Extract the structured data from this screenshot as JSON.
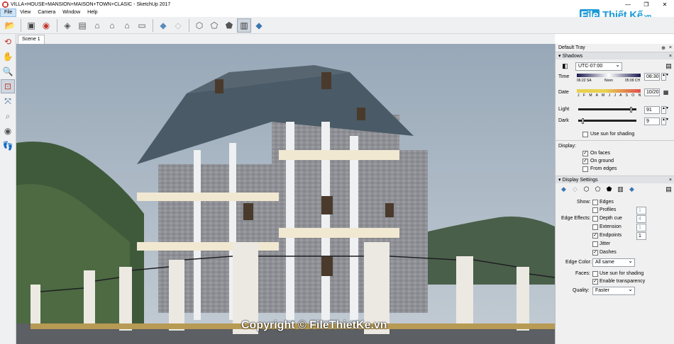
{
  "window": {
    "title": "VILLA+HOUSE+MANSION+MAISON+TOWN+CLASIC - SketchUp 2017",
    "controls": [
      "—",
      "❐",
      "✕"
    ]
  },
  "watermark_logo": {
    "prefix": "File",
    "main": "Thiết Kế",
    "suffix": ".vn"
  },
  "menu": [
    "File",
    "View",
    "Camera",
    "Window",
    "Help"
  ],
  "scene_tab": "Scene 1",
  "copyright": "Copyright © FileThietKe.vn",
  "tray": {
    "title": "Default Tray",
    "pin": "⊕",
    "close": "×",
    "shadows": {
      "header": "Shadows",
      "timezone": "UTC-07:00",
      "time_label": "Time",
      "sunrise": "06:22 SA",
      "noon": "Noon",
      "sunset": "05:09 CH",
      "time_value": "08:30",
      "date_label": "Date",
      "months": "J F M A M J J A S O N D",
      "date_value": "10/20",
      "light_label": "Light",
      "light_value": "91",
      "light_fraction": 0.91,
      "dark_label": "Dark",
      "dark_value": "9",
      "dark_fraction": 0.09,
      "use_sun": "Use sun for shading",
      "display_label": "Display:",
      "on_faces": "On faces",
      "on_ground": "On ground",
      "from_edges": "From edges"
    },
    "display_settings": {
      "header": "Display Settings",
      "show_label": "Show:",
      "edges": "Edges",
      "profiles": "Profiles",
      "profiles_value": "1",
      "edge_effects_label": "Edge Effects:",
      "depth_cue": "Depth cue",
      "depth_cue_value": "4",
      "extension": "Extension",
      "extension_value": "1",
      "endpoints": "Endpoints",
      "endpoints_value": "1",
      "jitter": "Jitter",
      "dashes": "Dashes",
      "edge_color_label": "Edge Color:",
      "edge_color_value": "All same",
      "faces_label": "Faces:",
      "use_sun_shading": "Use sun for shading",
      "enable_transparency": "Enable transparency",
      "quality_label": "Quality:",
      "quality_value": "Faster"
    }
  }
}
